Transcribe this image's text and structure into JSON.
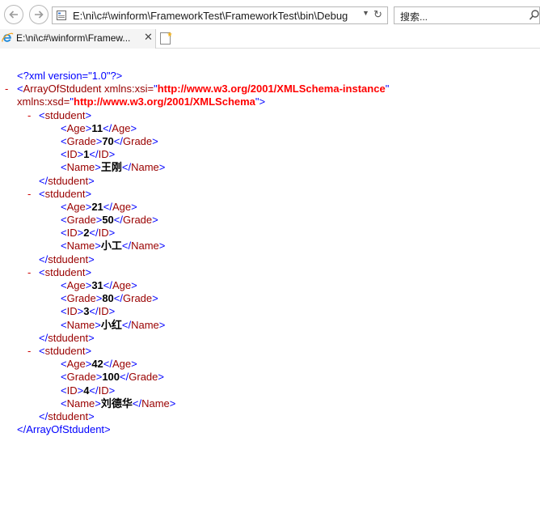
{
  "browser": {
    "address": "E:\\ni\\c#\\winform\\FrameworkTest\\FrameworkTest\\bin\\Debug",
    "search_placeholder": "搜索...",
    "tab_title": "E:\\ni\\c#\\winform\\Framew...",
    "icons": [
      "back-icon",
      "forward-icon",
      "page-icon",
      "dropdown-icon",
      "refresh-icon",
      "search-icon",
      "ie-icon",
      "close-icon",
      "new-tab-icon"
    ]
  },
  "xml": {
    "declaration": "<?xml version=\"1.0\"?>",
    "root": {
      "name": "ArrayOfStdudent",
      "xsi_attr": "xmlns:xsi",
      "xsi_value": "http://www.w3.org/2001/XMLSchema-instance",
      "xsd_attr": "xmlns:xsd",
      "xsd_value": "http://www.w3.org/2001/XMLSchema",
      "close": "</ArrayOfStdudent>"
    },
    "item_tag": "stdudent",
    "students": [
      {
        "Age": "11",
        "Grade": "70",
        "ID": "1",
        "Name": "王刚"
      },
      {
        "Age": "21",
        "Grade": "50",
        "ID": "2",
        "Name": "小工"
      },
      {
        "Age": "31",
        "Grade": "80",
        "ID": "3",
        "Name": "小红"
      },
      {
        "Age": "42",
        "Grade": "100",
        "ID": "4",
        "Name": "刘德华"
      }
    ],
    "minus_sign": "-"
  },
  "colors": {
    "tag": "#0000ff",
    "node_name": "#990000",
    "attr_value": "#ff0000",
    "text_value": "#000000",
    "collapse": "#cc0000"
  }
}
